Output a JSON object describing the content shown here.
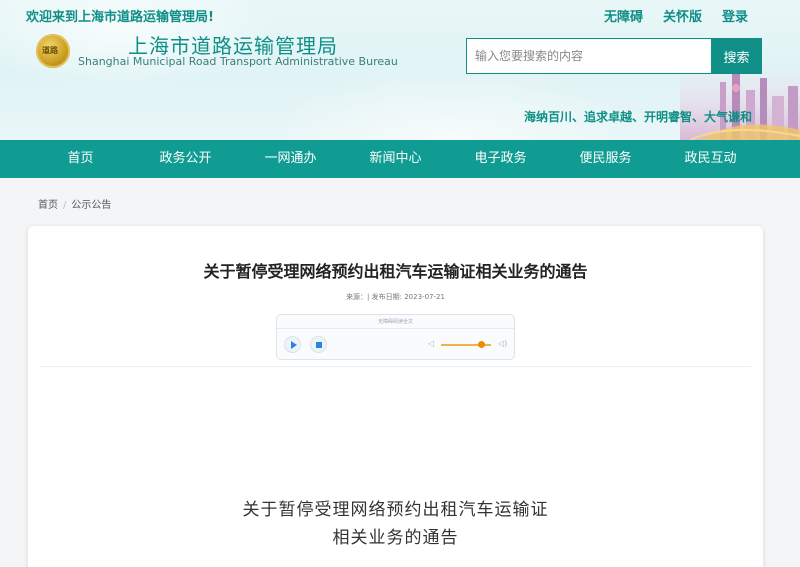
{
  "header": {
    "welcome": "欢迎来到上海市道路运输管理局!",
    "links": [
      "无障碍",
      "关怀版",
      "登录"
    ],
    "logo_text": "道路",
    "title_cn": "上海市道路运输管理局",
    "title_en": "Shanghai Municipal Road Transport Administrative Bureau",
    "search_placeholder": "输入您要搜索的内容",
    "search_button": "搜索",
    "slogan": "海纳百川、追求卓越、开明睿智、大气谦和"
  },
  "nav": {
    "items": [
      "首页",
      "政务公开",
      "一网通办",
      "新闻中心",
      "电子政务",
      "便民服务",
      "政民互动"
    ]
  },
  "breadcrumb": {
    "home": "首页",
    "separator": "/",
    "current": "公示公告"
  },
  "article": {
    "title": "关于暂停受理网络预约出租汽车运输证相关业务的通告",
    "meta": "来源：| 发布日期: 2023-07-21",
    "player_header": "无障碍阅读全文",
    "doc_title_line1": "关于暂停受理网络预约出租汽车运输证",
    "doc_title_line2": "相关业务的通告"
  },
  "colors": {
    "brand": "#109c93",
    "accent": "#108f87"
  }
}
